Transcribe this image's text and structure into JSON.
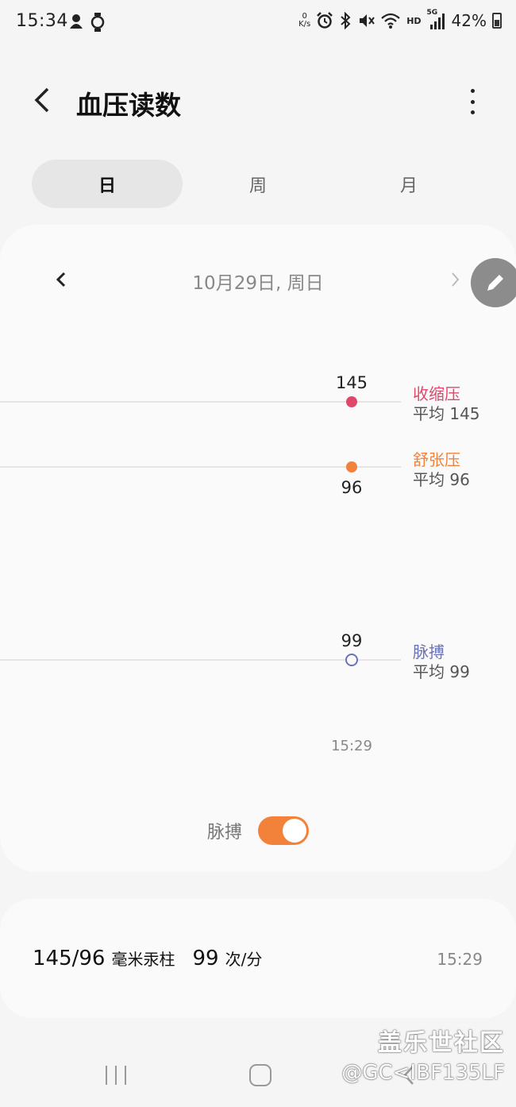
{
  "status_bar": {
    "time": "15:34",
    "net_speed_value": "0",
    "net_speed_unit": "K/s",
    "network_label": "HD",
    "signal_label": "5G",
    "battery": "42%"
  },
  "header": {
    "title": "血压读数"
  },
  "tabs": [
    {
      "label": "日",
      "active": true
    },
    {
      "label": "周",
      "active": false
    },
    {
      "label": "月",
      "active": false
    }
  ],
  "chart": {
    "date": "10月29日, 周日",
    "time_label": "15:29",
    "colors": {
      "systolic": "#e0476b",
      "diastolic": "#f2813a",
      "pulse": "#6a72b8"
    },
    "legend": [
      {
        "name": "收缩压",
        "avg": "平均 145"
      },
      {
        "name": "舒张压",
        "avg": "平均 96"
      },
      {
        "name": "脉搏",
        "avg": "平均 99"
      }
    ],
    "pulse_toggle_label": "脉搏",
    "pulse_toggle_on": true
  },
  "chart_data": {
    "type": "scatter",
    "x": [
      "15:29"
    ],
    "series": [
      {
        "name": "收缩压",
        "values": [
          145
        ]
      },
      {
        "name": "舒张压",
        "values": [
          96
        ]
      },
      {
        "name": "脉搏",
        "values": [
          99
        ]
      }
    ],
    "value_labels": [
      "145",
      "96",
      "99"
    ]
  },
  "reading": {
    "bp": "145/96",
    "bp_unit": "毫米汞柱",
    "pulse": "99",
    "pulse_unit": "次/分",
    "time": "15:29"
  },
  "watermark": {
    "line1": "盖乐世社区",
    "line2": "@GC<IBF135LF"
  }
}
